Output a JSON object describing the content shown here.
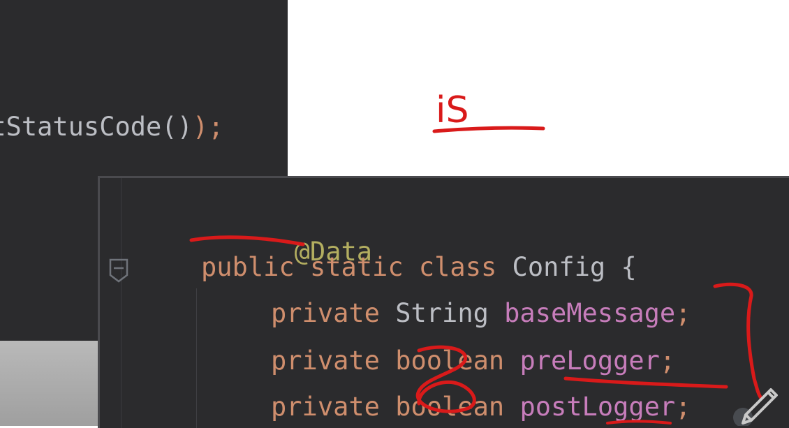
{
  "top_editor": {
    "line": {
      "text": "etStatusCode()",
      "punct": ");"
    }
  },
  "bottom_editor": {
    "lines": [
      {
        "annotation": "@Data"
      },
      {
        "kw1": "public",
        "kw2": "static",
        "kw3": "class",
        "name": "Config",
        "brace": "{"
      },
      {
        "kw": "private",
        "type": "String",
        "field": "baseMessage",
        "punct": ";"
      },
      {
        "kw": "private",
        "type": "boolean",
        "field": "preLogger",
        "punct": ";"
      },
      {
        "kw": "private",
        "type": "boolean",
        "field": "postLogger",
        "punct": ";"
      }
    ]
  },
  "whiteboard": {
    "ink_text": "iS"
  },
  "icons": {
    "fold": "fold-marker-icon",
    "pen": "pen-tool-icon"
  },
  "colors": {
    "editor_bg": "#2b2b2d",
    "keyword": "#cf8e6d",
    "annotation": "#b3ae60",
    "field": "#c77dbb",
    "text": "#bcbec4",
    "ink": "#d91a1a"
  }
}
